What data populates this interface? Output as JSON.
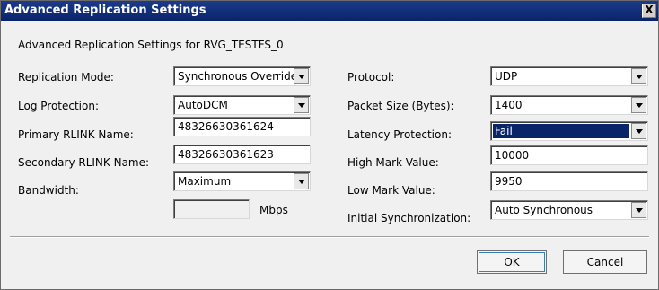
{
  "window": {
    "title": "Advanced Replication Settings",
    "close_label": "X"
  },
  "subtitle": "Advanced Replication Settings for RVG_TESTFS_0",
  "left": {
    "replication_mode": {
      "label": "Replication Mode:",
      "value": "Synchronous Override"
    },
    "log_protection": {
      "label": "Log Protection:",
      "value": "AutoDCM"
    },
    "primary_rlink": {
      "label": "Primary RLINK Name:",
      "value": "48326630361624"
    },
    "secondary_rlink": {
      "label": "Secondary RLINK Name:",
      "value": "48326630361623"
    },
    "bandwidth": {
      "label": "Bandwidth:",
      "value": "Maximum"
    },
    "mbps": {
      "value": "",
      "unit": "Mbps"
    }
  },
  "right": {
    "protocol": {
      "label": "Protocol:",
      "value": "UDP"
    },
    "packet_size": {
      "label": "Packet Size (Bytes):",
      "value": "1400"
    },
    "latency_protection": {
      "label": "Latency Protection:",
      "value": "Fail"
    },
    "high_mark": {
      "label": "High Mark Value:",
      "value": "10000"
    },
    "low_mark": {
      "label": "Low Mark Value:",
      "value": "9950"
    },
    "initial_sync": {
      "label": "Initial Synchronization:",
      "value": "Auto Synchronous"
    }
  },
  "buttons": {
    "ok": "OK",
    "cancel": "Cancel"
  }
}
